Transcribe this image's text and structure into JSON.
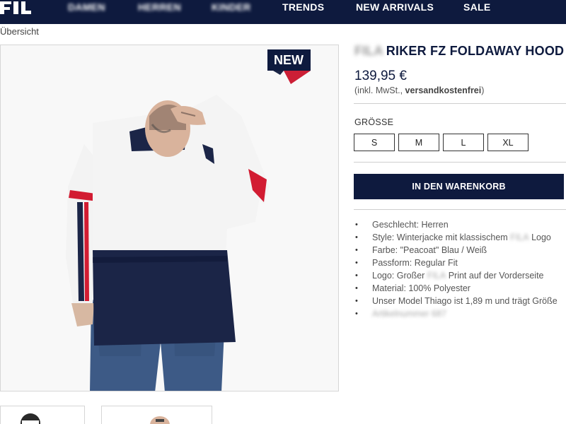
{
  "nav": {
    "logo_text": "FILA",
    "items": [
      "DAMEN",
      "HERREN",
      "KINDER",
      "TRENDS",
      "NEW ARRIVALS",
      "SALE"
    ]
  },
  "breadcrumb": {
    "back_label": "Übersicht"
  },
  "image": {
    "badge": "NEW"
  },
  "product": {
    "title_brand": "FILA",
    "title": "RIKER FZ FOLDAWAY HOOD",
    "price": "139,95 €",
    "tax_prefix": "(inkl. MwSt., ",
    "tax_bold": "versandkostenfrei",
    "tax_suffix": ")"
  },
  "sizes": {
    "label": "GRÖSSE",
    "options": [
      "S",
      "M",
      "L",
      "XL"
    ]
  },
  "cart": {
    "button_label": "IN DEN WARENKORB"
  },
  "features": {
    "geschlecht": "Geschlecht: Herren",
    "style_pre": "Style: Winterjacke mit klassischem ",
    "style_blur": "FILA",
    "style_post": " Logo",
    "farbe": "Farbe: \"Peacoat\" Blau / Weiß",
    "passform": "Passform: Regular Fit",
    "logo_pre": "Logo: Großer ",
    "logo_blur": "FILA",
    "logo_post": " Print auf der Vorderseite",
    "material": "Material: 100% Polyester",
    "model": "Unser Model Thiago ist 1,89 m und trägt Größe",
    "last_blur": "Artikelnummer 687"
  },
  "colors": {
    "navy": "#0e1a3e",
    "badge_red": "#cc1f36",
    "jacket_white": "#f4f4f4",
    "jacket_navy": "#1b2547",
    "stripe_red": "#d21c32",
    "denim": "#3d5a86"
  }
}
